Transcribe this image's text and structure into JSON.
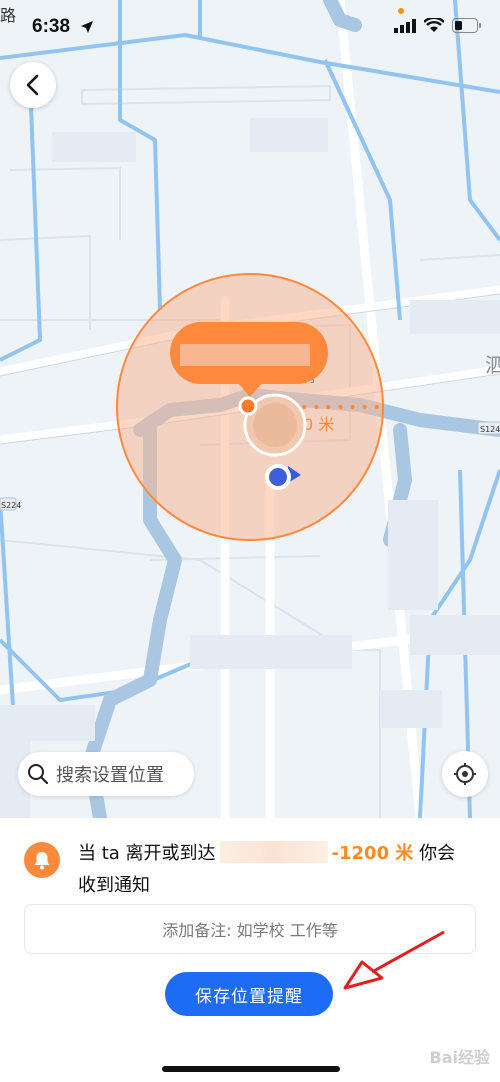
{
  "status_bar": {
    "time": "6:38",
    "partial_road_label": "路"
  },
  "map": {
    "distance_label": "00 米",
    "side_char": "泗",
    "road_badge_left": "S224",
    "road_badge_right": "S124",
    "partial_label": "村"
  },
  "search": {
    "placeholder": "搜索设置位置"
  },
  "notice": {
    "prefix": "当 ta 离开或到达",
    "distance": "-1200 米",
    "suffix": " 你会收到通知"
  },
  "note_field": {
    "placeholder": "添加备注: 如学校 工作等"
  },
  "save_button": {
    "label": "保存位置提醒"
  },
  "watermark": {
    "text": "Bai经验"
  },
  "colors": {
    "accent_blue": "#1e6cf5",
    "accent_orange": "#ff8a3d",
    "water": "#a9c7e2",
    "road": "#92c4f2"
  }
}
